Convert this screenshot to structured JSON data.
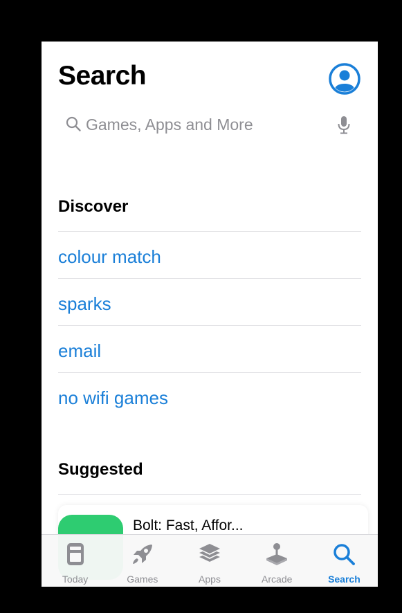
{
  "header": {
    "title": "Search"
  },
  "search": {
    "placeholder": "Games, Apps and More"
  },
  "discover": {
    "heading": "Discover",
    "items": [
      {
        "label": "colour match"
      },
      {
        "label": "sparks"
      },
      {
        "label": "email"
      },
      {
        "label": "no wifi games"
      }
    ]
  },
  "suggested": {
    "heading": "Suggested",
    "apps": [
      {
        "title": "Bolt: Fast, Affor..."
      }
    ]
  },
  "tabbar": {
    "tabs": [
      {
        "label": "Today",
        "icon": "today-icon"
      },
      {
        "label": "Games",
        "icon": "rocket-icon"
      },
      {
        "label": "Apps",
        "icon": "stack-icon"
      },
      {
        "label": "Arcade",
        "icon": "joystick-icon"
      },
      {
        "label": "Search",
        "icon": "search-icon",
        "active": true
      }
    ]
  },
  "colors": {
    "accent": "#1a7fd8",
    "background": "#ffffff",
    "frame": "#000000",
    "app_icon": "#2ecc71"
  }
}
